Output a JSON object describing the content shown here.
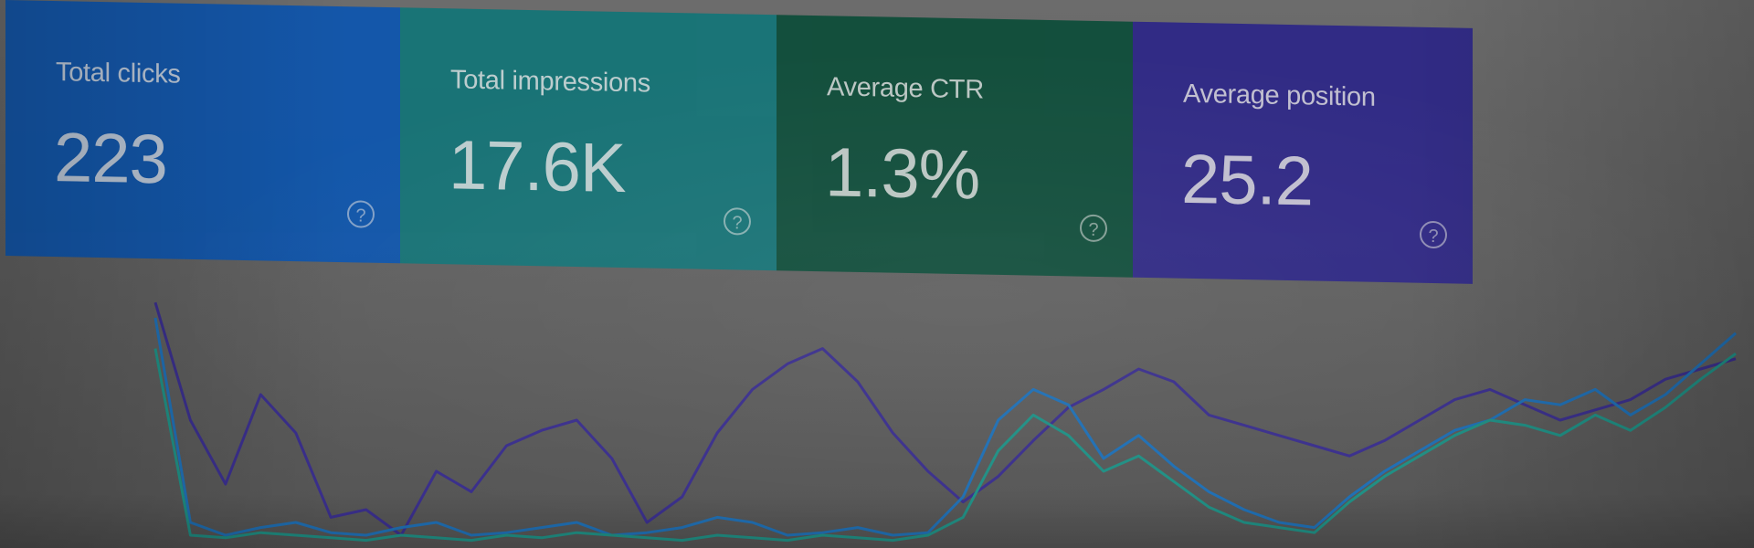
{
  "colors": {
    "clicks": "#0d56b0",
    "impressions": "#137578",
    "ctr": "#0c4d39",
    "position": "#2d2688"
  },
  "metrics": [
    {
      "label": "Total clicks",
      "value": "223",
      "help_icon": "help-circle-icon"
    },
    {
      "label": "Total impressions",
      "value": "17.6K",
      "help_icon": "help-circle-icon"
    },
    {
      "label": "Average CTR",
      "value": "1.3%",
      "help_icon": "help-circle-icon"
    },
    {
      "label": "Average position",
      "value": "25.2",
      "help_icon": "help-circle-icon"
    }
  ],
  "chart_data": {
    "type": "line",
    "series": [
      {
        "color": "#3a2f8c",
        "values": [
          0.96,
          0.5,
          0.25,
          0.6,
          0.45,
          0.12,
          0.15,
          0.05,
          0.3,
          0.22,
          0.4,
          0.46,
          0.5,
          0.35,
          0.1,
          0.2,
          0.45,
          0.62,
          0.72,
          0.78,
          0.65,
          0.45,
          0.3,
          0.18,
          0.28,
          0.42,
          0.55,
          0.62,
          0.7,
          0.65,
          0.52,
          0.48,
          0.44,
          0.4,
          0.36,
          0.42,
          0.5,
          0.58,
          0.62,
          0.56,
          0.5,
          0.54,
          0.58,
          0.66,
          0.7,
          0.74
        ]
      },
      {
        "color": "#1f6fb4",
        "values": [
          0.9,
          0.1,
          0.05,
          0.08,
          0.1,
          0.06,
          0.05,
          0.08,
          0.1,
          0.05,
          0.06,
          0.08,
          0.1,
          0.05,
          0.06,
          0.08,
          0.12,
          0.1,
          0.05,
          0.06,
          0.08,
          0.05,
          0.06,
          0.2,
          0.5,
          0.62,
          0.56,
          0.35,
          0.44,
          0.32,
          0.22,
          0.15,
          0.1,
          0.08,
          0.2,
          0.3,
          0.38,
          0.46,
          0.5,
          0.58,
          0.56,
          0.62,
          0.52,
          0.6,
          0.72,
          0.84
        ]
      },
      {
        "color": "#1f8f84",
        "values": [
          0.78,
          0.05,
          0.04,
          0.06,
          0.05,
          0.04,
          0.03,
          0.05,
          0.04,
          0.03,
          0.05,
          0.04,
          0.06,
          0.05,
          0.04,
          0.03,
          0.05,
          0.04,
          0.03,
          0.05,
          0.04,
          0.03,
          0.05,
          0.12,
          0.38,
          0.52,
          0.44,
          0.3,
          0.36,
          0.26,
          0.16,
          0.1,
          0.08,
          0.06,
          0.18,
          0.28,
          0.36,
          0.44,
          0.5,
          0.48,
          0.44,
          0.52,
          0.46,
          0.55,
          0.66,
          0.76
        ]
      }
    ]
  }
}
